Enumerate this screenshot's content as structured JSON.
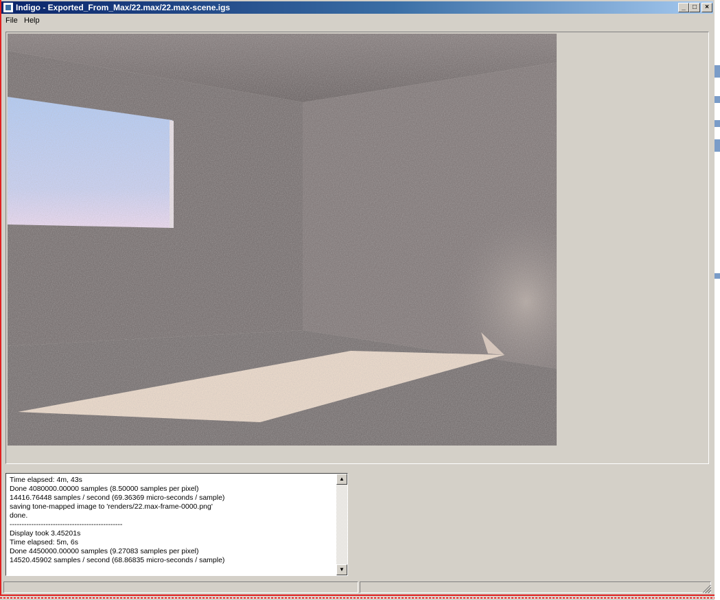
{
  "window": {
    "title": "Indigo - Exported_From_Max/22.max/22.max-scene.igs",
    "minimize_label": "_",
    "maximize_label": "□",
    "close_label": "×"
  },
  "menu": {
    "items": [
      "File",
      "Help"
    ]
  },
  "render": {
    "description_icon": "rendered-room-image"
  },
  "log": {
    "lines": [
      "Time elapsed: 4m, 43s",
      "Done 4080000.00000 samples (8.50000 samples per pixel)",
      "14416.76448 samples / second (69.36369 micro-seconds / sample)",
      "saving tone-mapped image to 'renders/22.max-frame-0000.png'",
      "done.",
      "-----------------------------------------------",
      "Display took 3.45201s",
      "Time elapsed: 5m, 6s",
      "Done 4450000.00000 samples (9.27083 samples per pixel)",
      "14520.45902 samples / second (68.86835 micro-seconds / sample)"
    ]
  },
  "scrollbar": {
    "up_icon": "arrow-up-icon",
    "down_icon": "arrow-down-icon",
    "up_glyph": "▲",
    "down_glyph": "▼"
  },
  "colors": {
    "titlebar_start": "#0a246a",
    "titlebar_end": "#a6caf0",
    "window_bg": "#d4d0c8",
    "frame_red": "#e02020"
  }
}
